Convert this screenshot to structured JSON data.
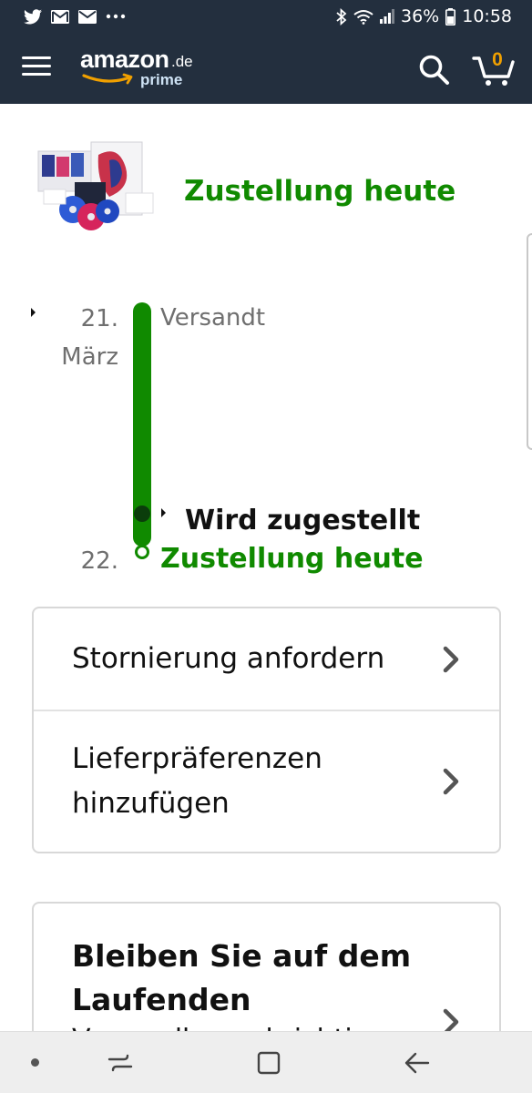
{
  "status_bar": {
    "battery": "36%",
    "time": "10:58",
    "icons": [
      "twitter-icon",
      "gmail-icon",
      "email-icon",
      "more-dots-icon",
      "bluetooth-icon",
      "wifi-icon",
      "signal-icon",
      "battery-icon"
    ]
  },
  "header": {
    "logo_word": "amazon",
    "logo_tld": ".de",
    "logo_sub": "prime",
    "cart_count": "0",
    "colors": {
      "background": "#232f3e",
      "smile": "#f0a000"
    }
  },
  "delivery": {
    "headline": "Zustellung heute",
    "accent_color": "#108a00"
  },
  "timeline": {
    "events": [
      {
        "date_day": "21.",
        "date_month": "März",
        "status": "Versandt"
      },
      {
        "status": "Wird zugestellt"
      },
      {
        "date_day": "22.",
        "status": "Zustellung heute"
      }
    ]
  },
  "actions": {
    "items": [
      {
        "label": "Stornierung anfordern"
      },
      {
        "label_line1": "Lieferpräferenzen",
        "label_line2": "hinzufügen"
      }
    ]
  },
  "updates_card": {
    "title_line1": "Bleiben Sie auf dem",
    "title_line2": "Laufenden",
    "subtitle_partial": "Versandbenachrichtigungen"
  },
  "nav_bar": {
    "icons": [
      "nav-dot-icon",
      "recent-apps-icon",
      "home-icon",
      "back-icon"
    ]
  }
}
